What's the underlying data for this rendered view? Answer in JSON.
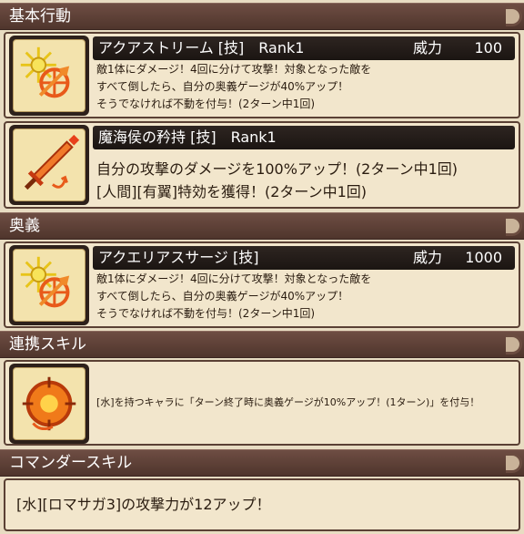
{
  "sections": {
    "basic": "基本行動",
    "ougi": "奥義",
    "renkei": "連携スキル",
    "commander": "コマンダースキル"
  },
  "skills": [
    {
      "name": "アクアストリーム [技]　Rank1",
      "power_label": "威力",
      "power": "100",
      "desc": [
        "敵1体にダメージ！4回に分けて攻撃！対象となった敵を",
        "すべて倒したら、自分の奥義ゲージが40%アップ！",
        "そうでなければ不動を付与！(2ターン中1回)"
      ]
    },
    {
      "name": "魔海侯の矜持 [技]　Rank1",
      "desc": [
        "自分の攻撃のダメージを100%アップ！(2ターン中1回)",
        "[人間][有翼]特効を獲得！(2ターン中1回)"
      ]
    },
    {
      "name": "アクエリアスサージ [技]",
      "power_label": "威力",
      "power": "1000",
      "desc": [
        "敵1体にダメージ！4回に分けて攻撃！対象となった敵を",
        "すべて倒したら、自分の奥義ゲージが40%アップ！",
        "そうでなければ不動を付与！(2ターン中1回)"
      ]
    }
  ],
  "renkei_desc": "[水]を持つキャラに「ターン終了時に奥義ゲージが10%アップ！(1ターン)」を付与！",
  "commander_desc": "[水][ロマサガ3]の攻撃力が12アップ！",
  "colors": {
    "header": "#5e4238",
    "card_bg": "#f2e6cc",
    "name_bar": "#231b17",
    "icon_bg": "#f3e3ad"
  }
}
